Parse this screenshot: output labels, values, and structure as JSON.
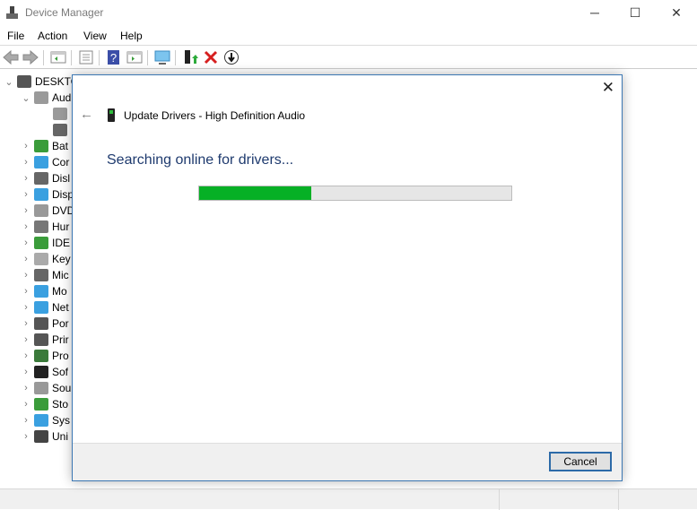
{
  "window": {
    "title": "Device Manager",
    "minimize": "─",
    "maximize": "☐",
    "close": "✕"
  },
  "menu": [
    "File",
    "Action",
    "View",
    "Help"
  ],
  "toolbar": [
    "back-icon",
    "forward-icon",
    "show-hide-console-tree-icon",
    "properties-icon",
    "help-icon",
    "action-pane-icon",
    "scan-hardware-icon",
    "update-driver-icon",
    "uninstall-icon",
    "disable-icon"
  ],
  "tree": {
    "root": "DESKTO",
    "items": [
      {
        "label": "Aud",
        "expanded": true,
        "color": "#9a9a9a"
      },
      {
        "label": "",
        "child": true,
        "color": "#9a9a9a"
      },
      {
        "label": "",
        "child": true,
        "color": "#666"
      },
      {
        "label": "Bat",
        "color": "#3a9c3a"
      },
      {
        "label": "Cor",
        "color": "#3aa0e0"
      },
      {
        "label": "Disl",
        "color": "#666"
      },
      {
        "label": "Disp",
        "color": "#3aa0e0"
      },
      {
        "label": "DVD",
        "color": "#999"
      },
      {
        "label": "Hur",
        "color": "#777"
      },
      {
        "label": "IDE",
        "color": "#3a9c3a"
      },
      {
        "label": "Key",
        "color": "#aaa"
      },
      {
        "label": "Mic",
        "color": "#666"
      },
      {
        "label": "Mo",
        "color": "#3aa0e0"
      },
      {
        "label": "Net",
        "color": "#3aa0e0"
      },
      {
        "label": "Por",
        "color": "#555"
      },
      {
        "label": "Prir",
        "color": "#555"
      },
      {
        "label": "Pro",
        "color": "#3a7a3a"
      },
      {
        "label": "Sof",
        "color": "#222"
      },
      {
        "label": "Sou",
        "color": "#999"
      },
      {
        "label": "Sto",
        "color": "#3a9c3a"
      },
      {
        "label": "Sys",
        "color": "#3aa0e0"
      },
      {
        "label": "Uni",
        "color": "#444"
      }
    ]
  },
  "dialog": {
    "close": "✕",
    "back": "←",
    "title": "Update Drivers - High Definition Audio",
    "heading": "Searching online for drivers...",
    "progress_percent": 36,
    "progress_color": "#06b025",
    "cancel": "Cancel"
  }
}
